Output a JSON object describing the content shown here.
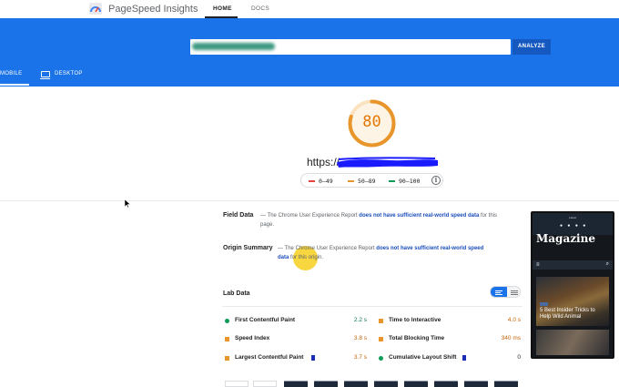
{
  "app": {
    "brand": "PageSpeed Insights",
    "nav": {
      "home": "HOME",
      "docs": "DOCS"
    }
  },
  "header": {
    "analyze_label": "ANALYZE",
    "tabs": {
      "mobile": "MOBILE",
      "desktop": "DESKTOP"
    }
  },
  "score": {
    "value": "80",
    "fraction": 0.8,
    "url_prefix": "https://",
    "legend": {
      "poor": "0–49",
      "average": "50–89",
      "good": "90–100"
    }
  },
  "colors": {
    "brand_blue": "#1a73e8",
    "score_orange": "#e8962b",
    "poor": "#e8453c",
    "good": "#0c9d58"
  },
  "field": {
    "title": "Field Data",
    "text_before": "— The Chrome User Experience Report ",
    "link": "does not have sufficient real-world speed data",
    "text_after": " for this page."
  },
  "origin": {
    "title": "Origin Summary",
    "text_before": "— The Chrome User Experience Report ",
    "link": "does not have sufficient real-world speed data",
    "text_after": " for this origin."
  },
  "lab": {
    "title": "Lab Data",
    "metrics": [
      {
        "label": "First Contentful Paint",
        "value": "2.2 s",
        "status": "green"
      },
      {
        "label": "Time to Interactive",
        "value": "4.0 s",
        "status": "orange"
      },
      {
        "label": "Speed Index",
        "value": "3.8 s",
        "status": "orange"
      },
      {
        "label": "Total Blocking Time",
        "value": "340 ms",
        "status": "orange"
      },
      {
        "label": "Largest Contentful Paint",
        "value": "3.7 s",
        "status": "orange"
      },
      {
        "label": "Cumulative Layout Shift",
        "value": "0",
        "status": "green"
      }
    ]
  },
  "preview": {
    "top_line": "Latest",
    "logo": "Magazine",
    "headline": "5 Best Insider Tricks to Help Wild Animal"
  }
}
